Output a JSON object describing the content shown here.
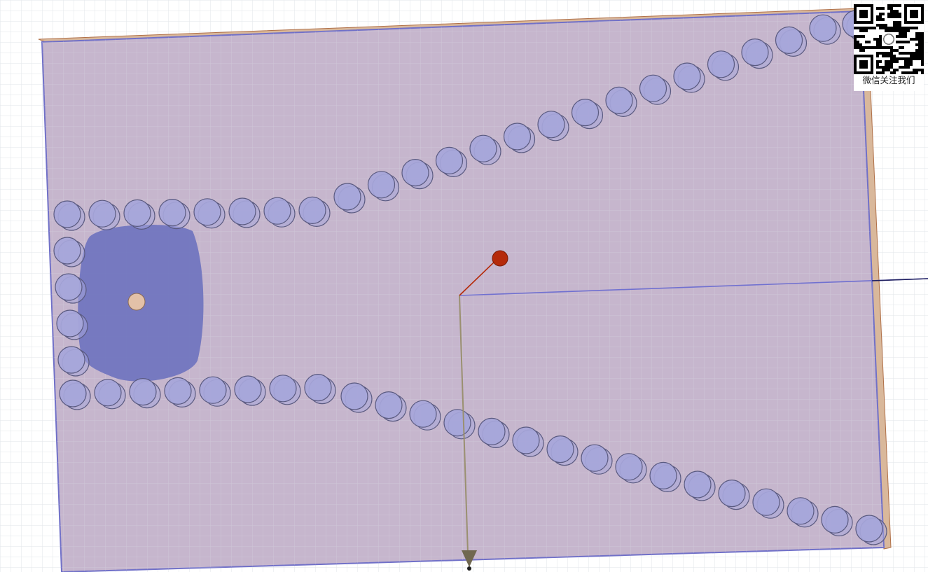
{
  "scene": {
    "type": "3d-model-viewport",
    "grid": true,
    "colors": {
      "background": "#ffffff",
      "grid": "#e2e6ea",
      "substrate_fill": "#c1b0c9",
      "substrate_edge": "#b07048",
      "substrate_side": "#d9b89b",
      "via_fill": "#a6a6da",
      "via_edge": "#5a5a80",
      "field_blob": "#6d72bf",
      "feed_pin": "#e3c1a8",
      "axis_z": "#9a9070",
      "axis_y": "#7070d0",
      "axis_x": "#b52a0a"
    },
    "via_rows": [
      "upper-row",
      "left-column",
      "lower-row"
    ],
    "axis_icons": [
      "origin-axis-z",
      "origin-axis-y",
      "origin-axis-x"
    ]
  },
  "overlay": {
    "qr_icon": "qr-code-icon",
    "qr_caption": "微信关注我们"
  }
}
